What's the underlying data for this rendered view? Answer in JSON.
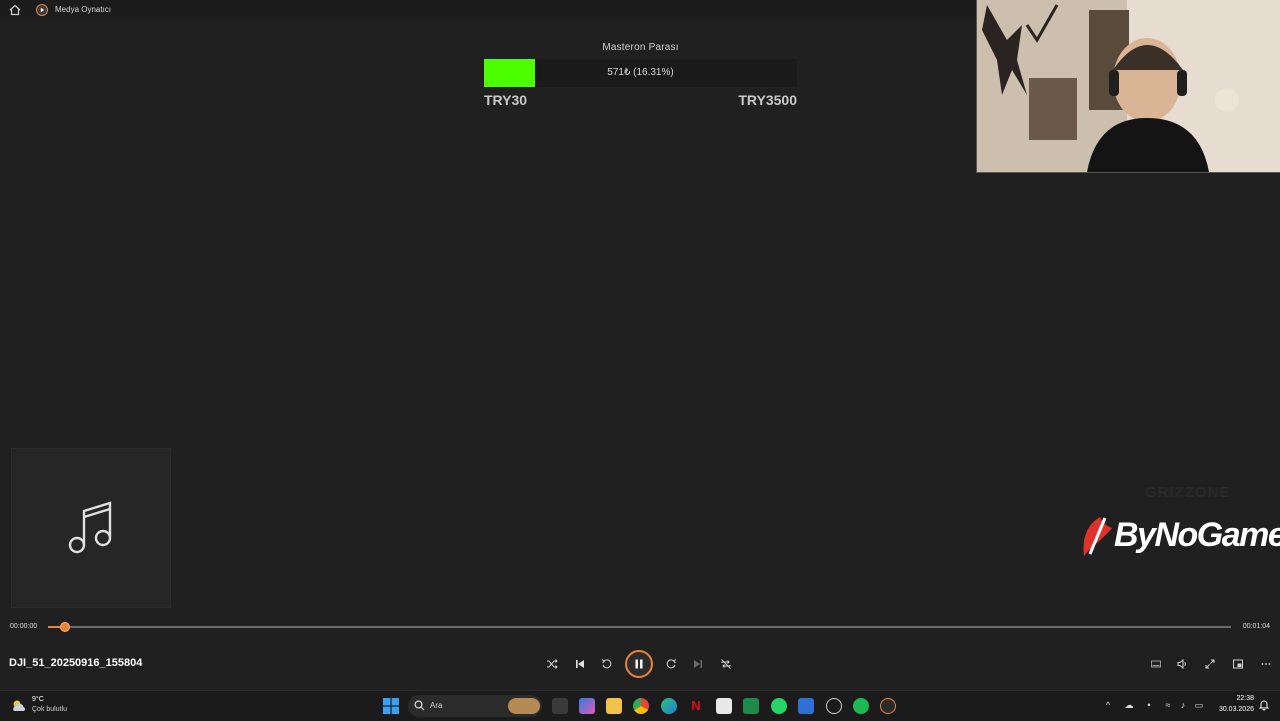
{
  "app": {
    "title": "Medya Oynatıcı"
  },
  "goal": {
    "title": "Masteron Parası",
    "progress_text": "571₺ (16.31%)",
    "progress_fraction": 0.1631,
    "min_label": "TRY30",
    "max_label": "TRY3500",
    "fill_color": "#4cff00"
  },
  "overlay": {
    "logo_text": "ByNoGame",
    "logo_color": "#e0322c",
    "watermark": "GRIZZONE"
  },
  "player": {
    "current_time": "00:00:00",
    "duration": "00:01:04",
    "position_fraction": 0.014,
    "track_name": "DJI_51_20250916_155804",
    "accent_color": "#e8833a",
    "controls": [
      "shuffle-icon",
      "previous-icon",
      "rewind-10-icon",
      "pause-icon",
      "forward-30-icon",
      "next-icon",
      "repeat-off-icon"
    ],
    "right_controls": [
      "miniplayer-icon",
      "volume-icon",
      "fullscreen-icon",
      "compact-icon",
      "more-icon"
    ]
  },
  "taskbar": {
    "weather_temp": "9°C",
    "weather_desc": "Çok bulutlu",
    "search_placeholder": "Ara",
    "time": "22:38",
    "date": "30.03.2026"
  }
}
